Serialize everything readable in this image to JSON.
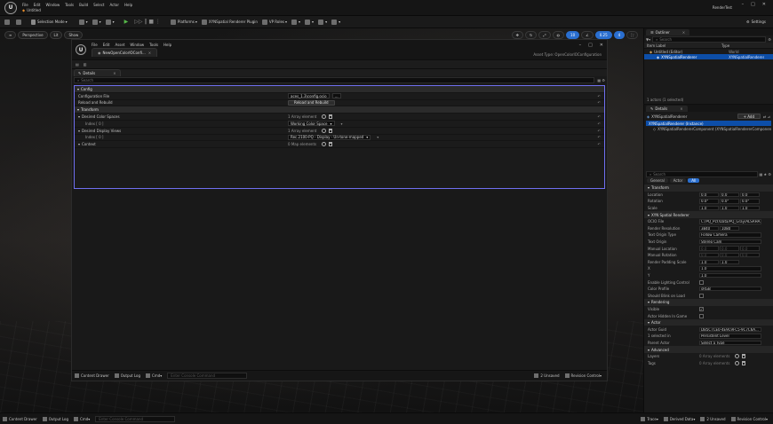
{
  "title_bar": {
    "project": "Untitled",
    "menu": [
      "File",
      "Edit",
      "Window",
      "Tools",
      "Build",
      "Select",
      "Actor",
      "Help"
    ],
    "app_name": "RenderTest",
    "controls": [
      "–",
      "□",
      "✕"
    ]
  },
  "toolbar": {
    "selection_mode": "Selection Mode",
    "platforms": "Platforms",
    "plugin": "XYNSpatial Renderer Plugin",
    "vp": "VP Roles",
    "settings": "Settings"
  },
  "viewport": {
    "perspective": "Perspective",
    "lit": "Lit",
    "show": "Show",
    "right_values": [
      "10",
      "0.25",
      "4"
    ]
  },
  "ocio_window": {
    "tab_title": "NewOpenColorIOConfi...",
    "menu": [
      "File",
      "Edit",
      "Asset",
      "Window",
      "Tools",
      "Help"
    ],
    "asset_type": "Asset Type: OpenColorIOConfiguration",
    "details_tab": "Details",
    "search_placeholder": "Search",
    "rows": [
      {
        "kind": "cat",
        "name": "Config"
      },
      {
        "kind": "prop",
        "name": "Configuration File",
        "value": "aces_1.3\\config.ocio"
      },
      {
        "kind": "prop",
        "name": "Reload and Rebuild",
        "button": "Reload and Rebuild"
      },
      {
        "kind": "cat",
        "name": "Transform"
      },
      {
        "kind": "prop",
        "name": "Desired Color Spaces",
        "value": "1 Array element"
      },
      {
        "kind": "sub",
        "name": "Index [ 0 ]",
        "value": "Working Color Space"
      },
      {
        "kind": "prop",
        "name": "Desired Display Views",
        "value": "1 Array element"
      },
      {
        "kind": "sub",
        "name": "Index [ 0 ]",
        "value": "Rec.2100-PQ - Display - Un-tone-mapped"
      },
      {
        "kind": "prop",
        "name": "Context",
        "value": "0 Map elements"
      }
    ],
    "status": {
      "content_drawer": "Content Drawer",
      "output_log": "Output Log",
      "cmd": "Cmd",
      "console_placeholder": "Enter Console Command",
      "unsaved": "2 Unsaved",
      "revision": "Revision Control"
    }
  },
  "outliner": {
    "tab": "Outliner",
    "search_placeholder": "Search",
    "col_label": "Item Label",
    "col_type": "Type",
    "items": [
      {
        "label": "Untitled (Editor)",
        "type": "World",
        "selected": false
      },
      {
        "label": "XYNSpatialRenderer",
        "type": "XYNSpatialRenderer",
        "selected": true
      }
    ],
    "footer": "1 actors (1 selected)"
  },
  "details": {
    "tab": "Details",
    "actor": "XYNSpatialRenderer",
    "add_button": "+ Add",
    "instance": "XYNSpatialRenderer (Instance)",
    "component": "XYNSpatialRendererComponent (XYNSpatialRendererComponent)",
    "search_placeholder": "Search",
    "filter_tabs": [
      "General",
      "Actor",
      "All"
    ],
    "rows": [
      {
        "kind": "cat",
        "label": "Transform"
      },
      {
        "kind": "vec",
        "label": "Location",
        "v": [
          "0.0",
          "0.0",
          "0.0"
        ]
      },
      {
        "kind": "vec",
        "label": "Rotation",
        "v": [
          "0.0°",
          "0.0°",
          "0.0°"
        ]
      },
      {
        "kind": "vec",
        "label": "Scale",
        "v": [
          "1.0",
          "1.0",
          "1.0"
        ]
      },
      {
        "kind": "cat",
        "label": "XYN Spatial Renderer"
      },
      {
        "kind": "text",
        "label": "OCIO File",
        "v": "C:/PQ_PLY/Data/PQ_Gray/ALSRHA..."
      },
      {
        "kind": "vec2",
        "label": "Render Resolution",
        "v": [
          "3840",
          "1080"
        ]
      },
      {
        "kind": "text",
        "label": "Text Origin Type",
        "v": "Follow Camera"
      },
      {
        "kind": "text",
        "label": "Text Origin",
        "v": "Stereo Cam"
      },
      {
        "kind": "vecdim",
        "label": "Manual Location",
        "v": [
          "0.0",
          "0.0",
          "0.0"
        ]
      },
      {
        "kind": "vecdim",
        "label": "Manual Rotation",
        "v": [
          "0.0",
          "0.0",
          "0.0"
        ]
      },
      {
        "kind": "vec2",
        "label": "Render Padding Scale",
        "v": [
          "1.0",
          "1.0"
        ]
      },
      {
        "kind": "text",
        "label": "X",
        "v": "1.0"
      },
      {
        "kind": "text",
        "label": "Y",
        "v": "1.0"
      },
      {
        "kind": "check",
        "label": "Enable Lighting Control",
        "v": ""
      },
      {
        "kind": "text",
        "label": "Color Profile",
        "v": "sRGB"
      },
      {
        "kind": "check",
        "label": "Should Blink on Load",
        "v": ""
      },
      {
        "kind": "cat",
        "label": "Rendering"
      },
      {
        "kind": "check",
        "label": "Visible",
        "v": "✓"
      },
      {
        "kind": "check",
        "label": "Actor Hidden In Game",
        "v": ""
      },
      {
        "kind": "cat",
        "label": "Actor"
      },
      {
        "kind": "text",
        "label": "Actor Guid",
        "v": "DB5C7CE0-4E9C9FC5-9C7C6A..."
      },
      {
        "kind": "text",
        "label": "1 selected in",
        "v": "Persistent Level"
      },
      {
        "kind": "text",
        "label": "Parent Actor",
        "v": "Select a Type"
      },
      {
        "kind": "cat",
        "label": "Advanced"
      },
      {
        "kind": "arr",
        "label": "Layers",
        "v": "0 Array elements"
      },
      {
        "kind": "arr",
        "label": "Tags",
        "v": "0 Array elements"
      }
    ]
  },
  "status_bar": {
    "content_drawer": "Content Drawer",
    "output_log": "Output Log",
    "cmd": "Cmd",
    "console_placeholder": "Enter Console Command",
    "trace": "Trace",
    "derived": "Derived Data",
    "unsaved": "2 Unsaved",
    "revision": "Revision Control"
  }
}
